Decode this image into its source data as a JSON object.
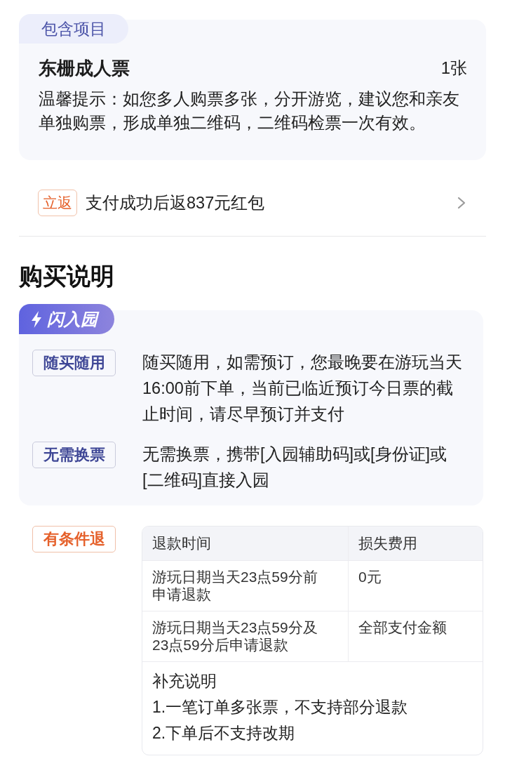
{
  "included": {
    "tab": "包含项目",
    "ticket": {
      "name": "东栅成人票",
      "quantity": "1张"
    },
    "tip": "温馨提示：如您多人购票多张，分开游览，建议您和亲友单独购票，形成单独二维码，二维码检票一次有效。"
  },
  "promo": {
    "badge": "立返",
    "text": "支付成功后返837元红包"
  },
  "purchase_info": {
    "heading": "购买说明",
    "banner": "闪入园",
    "rules": [
      {
        "tag": "随买随用",
        "text": "随买随用，如需预订，您最晚要在游玩当天16:00前下单，当前已临近预订今日票的截止时间，请尽早预订并支付"
      },
      {
        "tag": "无需换票",
        "text": "无需换票，携带[入园辅助码]或[身份证]或[二维码]直接入园"
      }
    ],
    "refund": {
      "tag": "有条件退",
      "columns": [
        "退款时间",
        "损失费用"
      ],
      "rows": [
        [
          "游玩日期当天23点59分前申请退款",
          "0元"
        ],
        [
          "游玩日期当天23点59分及23点59分后申请退款",
          "全部支付金额"
        ]
      ],
      "notes_title": "补充说明",
      "notes": [
        "1.一笔订单多张票，不支持部分退款",
        "2.下单后不支持改期"
      ]
    }
  }
}
